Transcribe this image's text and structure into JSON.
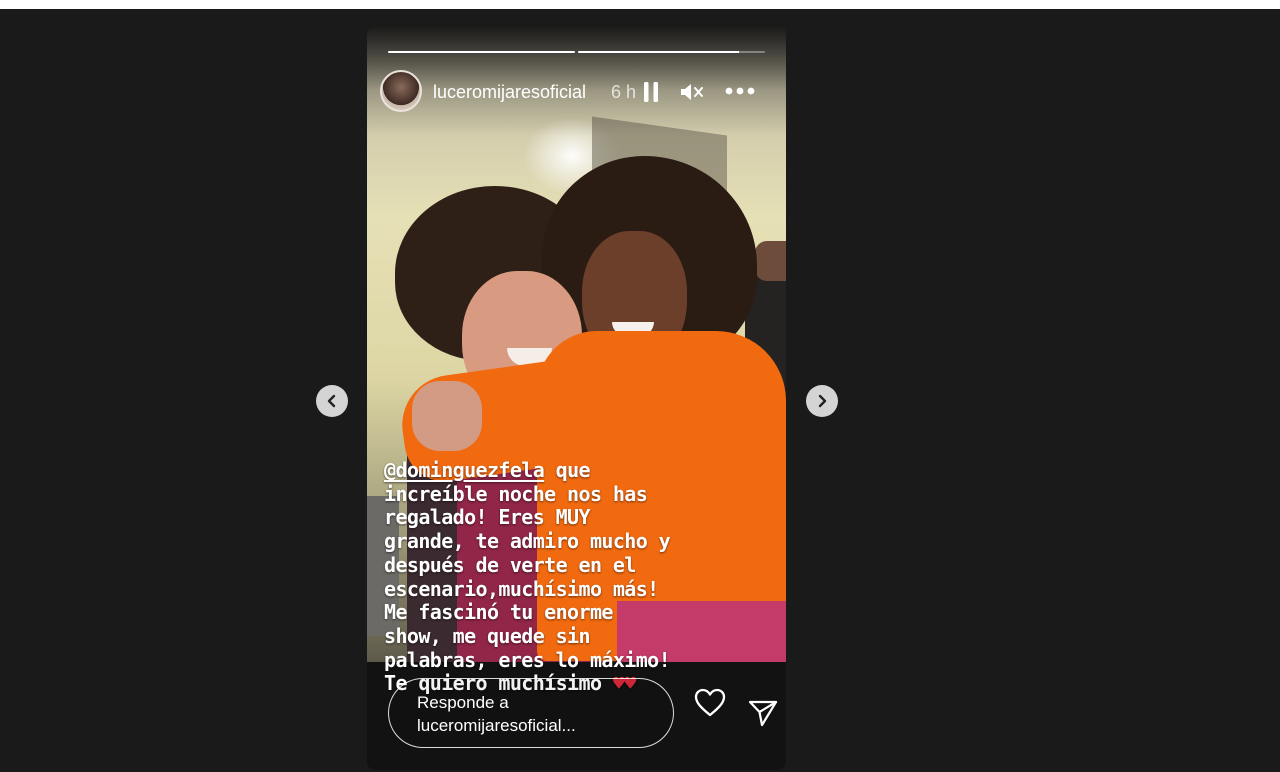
{
  "story": {
    "username": "luceromijaresoficial",
    "timestamp": "6 h",
    "progress": [
      1.0,
      0.86
    ],
    "caption": {
      "mention": "@dominguezfela",
      "text": " que increíble noche nos has regalado! Eres MUY grande, te admiro mucho y después de verte en el escenario,muchísimo más! Me fascinó tu enorme show, me quede sin palabras, eres lo máximo! Te quiero muchísimo ",
      "hearts": "♥♥"
    },
    "reply_placeholder": "Responde a luceromijaresoficial...",
    "icons": {
      "pause": "pause-icon",
      "mute": "muted-speaker-icon",
      "more": "more-options-icon",
      "like": "heart-icon",
      "share": "send-icon",
      "prev": "chevron-left-icon",
      "next": "chevron-right-icon"
    },
    "colors": {
      "background": "#1a1a1a",
      "story_background": "#121212",
      "sweater": "#f26a10",
      "heart": "#d62a3a"
    }
  }
}
